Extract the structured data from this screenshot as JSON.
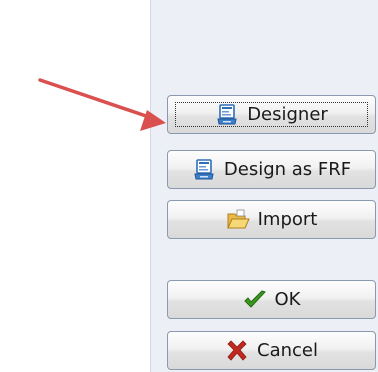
{
  "buttons": {
    "designer": {
      "label": "Designer",
      "icon": "designer-icon"
    },
    "design_as_frf": {
      "label": "Design as FRF",
      "icon": "designer-icon"
    },
    "import": {
      "label": "Import",
      "icon": "folder-open-icon"
    },
    "ok": {
      "label": "OK",
      "icon": "checkmark-icon"
    },
    "cancel": {
      "label": "Cancel",
      "icon": "x-icon"
    }
  },
  "colors": {
    "arrow": "#d9504f",
    "panel_background": "#ecf0f6",
    "ok_check": "#3a9a1e",
    "cancel_x": "#c0291f"
  }
}
